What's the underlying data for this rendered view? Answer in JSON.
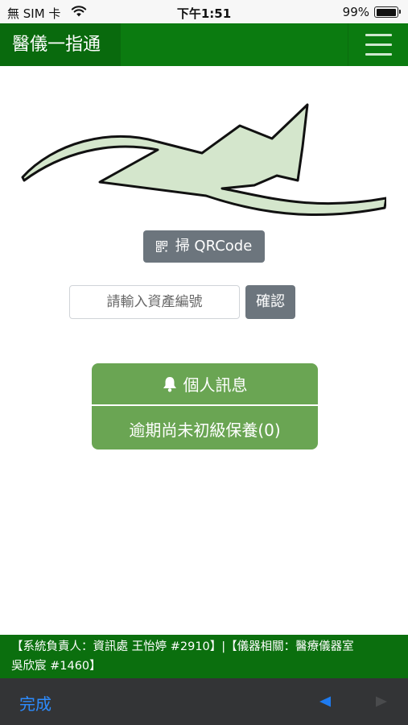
{
  "status_bar": {
    "carrier": "無 SIM 卡",
    "time": "下午1:51",
    "battery_percent": "99%",
    "battery_level": 0.99
  },
  "navbar": {
    "title": "醫儀一指通",
    "menu_icon": "hamburger-menu-icon"
  },
  "logo": {
    "icon": "swoosh-logo",
    "color": "#d4e6cc"
  },
  "scan_button": {
    "icon": "qrcode-icon",
    "label": "掃 QRCode"
  },
  "asset_search": {
    "placeholder": "請輸入資產編號",
    "value": "",
    "confirm_label": "確認"
  },
  "messages": {
    "header_icon": "bell-icon",
    "header_label": "個人訊息",
    "overdue_label": "逾期尚未初級保養(0)"
  },
  "footer": {
    "line1": "【系統負責人：資訊處 王怡婷 #2910】|【儀器相關：醫療儀器室",
    "line2": "吳欣宸 #1460】"
  },
  "keyboard_toolbar": {
    "done_label": "完成",
    "prev_icon": "triangle-left-icon",
    "next_icon": "triangle-right-icon"
  },
  "colors": {
    "navbar": "#0b7b10",
    "brand_bg": "#096a0d",
    "gray_button": "#6c757d",
    "message_green": "#6aa553",
    "footer_green": "#0b6f0e",
    "toolbar": "#333436",
    "done_blue": "#2d8cff"
  }
}
